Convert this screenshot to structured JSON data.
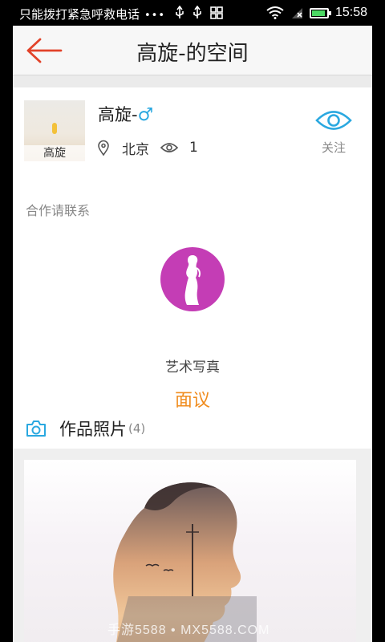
{
  "status_bar": {
    "carrier_text": "只能拨打紧急呼救电话",
    "dots": "•••",
    "time": "15:58"
  },
  "header": {
    "title": "高旋-的空间",
    "back_icon": "back-arrow-icon",
    "accent_color": "#e2432a"
  },
  "profile": {
    "avatar_label": "高旋",
    "name": "高旋-",
    "gender_symbol": "♂",
    "location": "北京",
    "view_count": "1",
    "follow_label": "关注",
    "contact_note": "合作请联系"
  },
  "service": {
    "icon": "woman-silhouette-icon",
    "name": "艺术写真",
    "price": "面议",
    "icon_color": "#c43db5",
    "price_color": "#f08c1e"
  },
  "works": {
    "title": "作品照片",
    "count": "(4)",
    "icon": "camera-icon"
  },
  "photo": {
    "watermark": "手游5588 • MX5588.COM"
  }
}
